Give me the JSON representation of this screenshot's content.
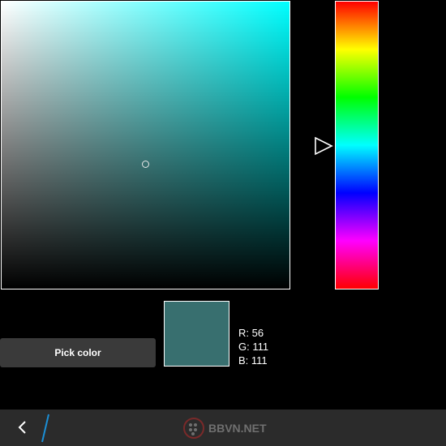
{
  "picker": {
    "hue_color": "#00ffff",
    "selected_color": "#386f6f",
    "hue_degrees": 180,
    "saturation": 0.5,
    "value": 0.435
  },
  "buttons": {
    "pick_color_label": "Pick color"
  },
  "readout": {
    "r": "R: 56",
    "g": "G: 111",
    "b": "B: 111"
  },
  "action_bar": {
    "back_icon": "chevron-left-icon",
    "watermark": "BBVN.NET"
  },
  "colors": {
    "background": "#000000",
    "button_bg": "#3a3a3a",
    "action_bar_bg": "#2b2b2b",
    "accent_slash": "#1b8fd6"
  }
}
